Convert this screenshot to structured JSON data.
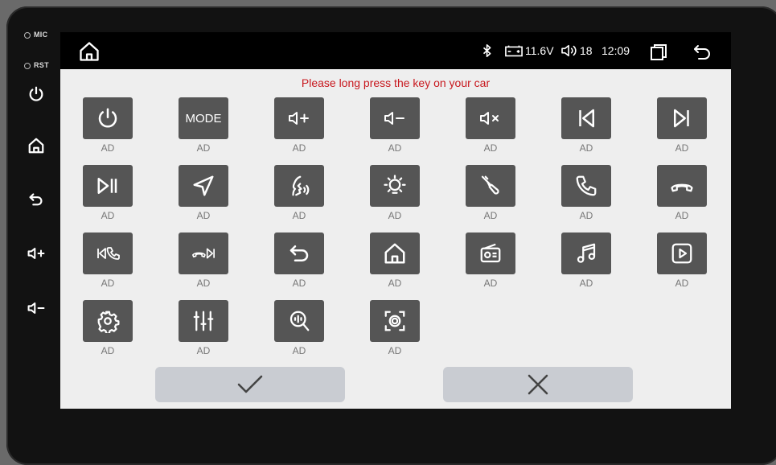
{
  "side_panel": {
    "mic_label": "MIC",
    "rst_label": "RST",
    "buttons": [
      "power-icon",
      "home-icon",
      "back-icon",
      "volume-up-icon",
      "volume-down-icon"
    ]
  },
  "status_bar": {
    "voltage": "11.6V",
    "volume": "18",
    "time": "12:09"
  },
  "dialog": {
    "title": "Please long press the key on your car",
    "keys": [
      {
        "icon": "power-icon",
        "label": "AD"
      },
      {
        "icon": "mode",
        "text": "MODE",
        "label": "AD"
      },
      {
        "icon": "volume-up-icon",
        "label": "AD"
      },
      {
        "icon": "volume-down-icon",
        "label": "AD"
      },
      {
        "icon": "mute-icon",
        "label": "AD"
      },
      {
        "icon": "previous-track-icon",
        "label": "AD"
      },
      {
        "icon": "next-track-icon",
        "label": "AD"
      },
      {
        "icon": "play-pause-icon",
        "label": "AD"
      },
      {
        "icon": "navigation-icon",
        "label": "AD"
      },
      {
        "icon": "voice-assistant-icon",
        "label": "AD"
      },
      {
        "icon": "brightness-icon",
        "label": "AD"
      },
      {
        "icon": "aux-cable-icon",
        "label": "AD"
      },
      {
        "icon": "phone-answer-icon",
        "label": "AD"
      },
      {
        "icon": "phone-hangup-icon",
        "label": "AD"
      },
      {
        "icon": "prev-answer-icon",
        "label": "AD"
      },
      {
        "icon": "hangup-next-icon",
        "label": "AD"
      },
      {
        "icon": "back-icon",
        "label": "AD"
      },
      {
        "icon": "home-icon",
        "label": "AD"
      },
      {
        "icon": "radio-icon",
        "label": "AD"
      },
      {
        "icon": "music-icon",
        "label": "AD"
      },
      {
        "icon": "video-play-icon",
        "label": "AD"
      },
      {
        "icon": "settings-icon",
        "label": "AD"
      },
      {
        "icon": "equalizer-icon",
        "label": "AD"
      },
      {
        "icon": "voice-search-icon",
        "label": "AD"
      },
      {
        "icon": "camera-icon",
        "label": "AD"
      }
    ],
    "confirm_icon": "checkmark-icon",
    "cancel_icon": "close-icon"
  }
}
